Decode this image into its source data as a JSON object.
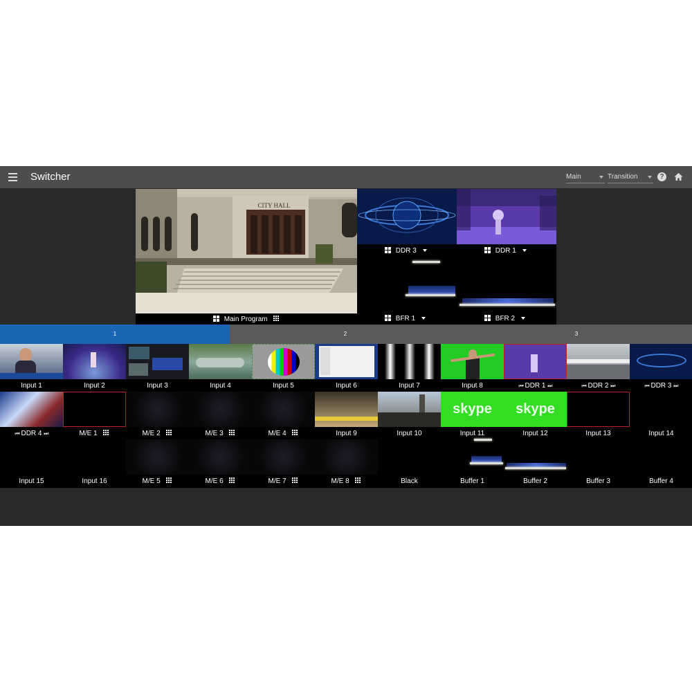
{
  "app": {
    "title": "Switcher"
  },
  "toolbar": {
    "main_select": "Main",
    "transition_select": "Transition",
    "help_icon": "?"
  },
  "program": {
    "label": "Main Program"
  },
  "monitors": [
    {
      "label": "DDR 3"
    },
    {
      "label": "DDR 1"
    },
    {
      "label": "BFR 1"
    },
    {
      "label": "BFR 2"
    }
  ],
  "tabs": [
    "1",
    "2",
    "3"
  ],
  "row1": [
    "Input 1",
    "Input 2",
    "Input 3",
    "Input 4",
    "Input 5",
    "Input 6",
    "Input 7",
    "Input 8",
    "DDR 1",
    "DDR 2",
    "DDR 3"
  ],
  "row2": [
    "DDR 4",
    "M/E 1",
    "M/E 2",
    "M/E 3",
    "M/E 4",
    "Input 9",
    "Input 10",
    "Input 11",
    "Input 12",
    "Input 13",
    "Input 14"
  ],
  "row3": [
    "Input 15",
    "Input 16",
    "M/E 5",
    "M/E 6",
    "M/E 7",
    "M/E 8",
    "Black",
    "Buffer 1",
    "Buffer 2",
    "Buffer 3",
    "Buffer 4"
  ],
  "thumb_text": {
    "skype": "skype",
    "city_hall": "CITY HALL"
  },
  "colors": {
    "active_tab": "#1b65b5",
    "topbar": "#4d4d4d",
    "skype_green": "#33dd22",
    "preview_red": "#c0202a"
  }
}
